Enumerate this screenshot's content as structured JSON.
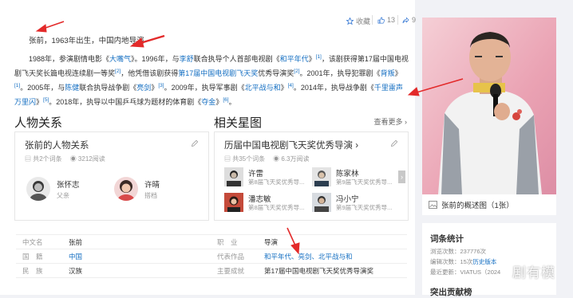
{
  "toolbar": {
    "favorite_label": "收藏",
    "like_count": "13",
    "share_count": "9"
  },
  "intro": "张前，1963年出生，中国内地导演",
  "career": {
    "p1_a": "1988年，参演剧情电影《",
    "film1": "大嘴气",
    "p1_b": "》。1996年，与",
    "person1": "李舒",
    "p1_c": "联合执导个人首部电视剧《",
    "drama1": "和平年代",
    "p1_d": "》",
    "ref1": "[1]",
    "p1_e": "，该剧获得第17届中国电视剧飞天奖长篇电视连续剧一等奖",
    "ref2": "[2]",
    "p1_f": "，他凭借该剧获得",
    "award1": "第17届中国电视剧飞天奖",
    "p1_g": "优秀导演奖",
    "ref3": "[2]",
    "p1_h": "。2001年，执导犯罪剧《",
    "drama2": "背叛",
    "p1_i": "》",
    "ref4": "[1]",
    "p2_a": "。2005年，与",
    "person2": "陈健",
    "p2_b": "联合执导战争剧《",
    "drama3": "亮剑",
    "p2_c": "》",
    "ref5": "[3]",
    "p2_d": "。2009年，执导军事剧《",
    "drama4": "北平战与和",
    "p2_e": "》",
    "ref6": "[4]",
    "p2_f": "。2014年，执导战争剧《",
    "drama5": "千里雷声万里闪",
    "p2_g": "》",
    "ref7": "[5]",
    "p2_h": "。2018年，执导以中国乒乓球为题材的体育剧《",
    "drama6": "夺金",
    "p2_i": "》",
    "ref8": "[6]",
    "p2_j": "。"
  },
  "relations": {
    "section_title": "人物关系",
    "card_title": "张前的人物关系",
    "count": "共2个词条",
    "views": "3212阅读",
    "people": [
      {
        "name": "张怀志",
        "relation": "父亲"
      },
      {
        "name": "许晴",
        "relation": "搭档"
      }
    ]
  },
  "stars": {
    "section_title": "相关星图",
    "more_label": "查看更多",
    "card_title": "历届中国电视剧飞天奖优秀导演",
    "count": "共35个词条",
    "views": "6.3万阅读",
    "items": [
      {
        "name": "许雷",
        "desc": "第8届飞天奖优秀导..."
      },
      {
        "name": "陈家林",
        "desc": "第9届飞天奖优秀导..."
      },
      {
        "name": "潘志敏",
        "desc": "第8届飞天奖优秀导..."
      },
      {
        "name": "冯小宁",
        "desc": "第9届飞天奖优秀导..."
      }
    ]
  },
  "basic_info": {
    "chinese_name_label": "中文名",
    "chinese_name": "张前",
    "nationality_label": "国　籍",
    "nationality": "中国",
    "ethnicity_label": "民　族",
    "ethnicity": "汉族",
    "occupation_label": "职　业",
    "occupation": "导演",
    "works_label": "代表作品",
    "works": "和平年代、亮剑、北平战与和",
    "achievement_label": "主要成就",
    "achievement": "第17届中国电视剧飞天奖优秀导演奖"
  },
  "sidebar": {
    "photo_caption": "张前的概述图（1张）",
    "stats_title": "词条统计",
    "views_label": "浏览次数：",
    "views_value": "237776次",
    "edits_label": "编辑次数：",
    "edits_value": "15次",
    "history_link": "历史版本",
    "last_edit_label": "最近更新：",
    "last_edit_value": "VIATUS（2024",
    "next_title": "突出贡献榜"
  },
  "watermark": "剧有模"
}
